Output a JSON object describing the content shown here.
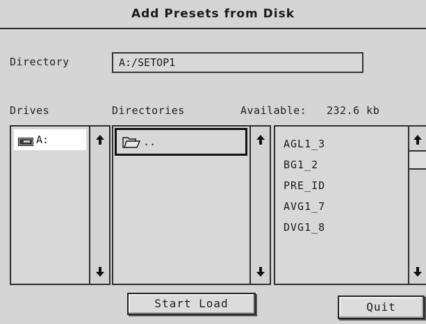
{
  "window": {
    "title": "Add Presets from Disk"
  },
  "directory": {
    "label": "Directory",
    "value": "A:/SETOP1"
  },
  "drives": {
    "label": "Drives",
    "items": [
      {
        "label": "A:",
        "icon": "disk-drive-icon"
      }
    ]
  },
  "directories": {
    "label": "Directories",
    "items": [
      {
        "label": "..",
        "icon": "folder-open-icon"
      }
    ]
  },
  "available": {
    "label": "Available:",
    "value": "232.6 kb"
  },
  "files": {
    "items": [
      "AGL1_3",
      "BG1_2",
      "PRE_ID",
      "AVG1_7",
      "DVG1_8"
    ]
  },
  "buttons": {
    "start_load": "Start Load",
    "quit": "Quit"
  }
}
